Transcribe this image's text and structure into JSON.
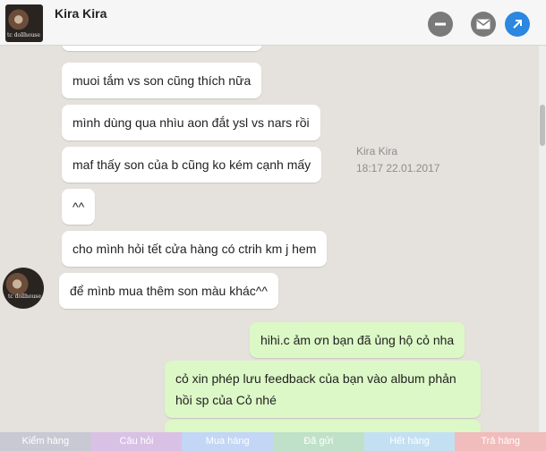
{
  "header": {
    "contact_name": "Kira Kira",
    "avatar_watermark": "tc dollhouse"
  },
  "messages": [
    {
      "text": "muoi tắm vs son cũng thích nữa"
    },
    {
      "text": "mình dùng qua nhìu aon đắt ysl vs nars rồi"
    },
    {
      "text": "maf thấy son của b cũng ko kém cạnh mấy"
    },
    {
      "text": "^^"
    },
    {
      "text": "cho mình hỏi tết cửa hàng có ctrih km j hem"
    },
    {
      "text": "để mìnb mua thêm son màu khác^^"
    },
    {
      "text": "hihi.c ảm ơn bạn đã ủng hộ cỏ nha"
    },
    {
      "text": "cỏ xin phép lưu feedback của bạn vào album phản hồi sp của Cỏ nhé"
    }
  ],
  "meta": {
    "sender": "Kira Kira",
    "timestamp": "18:17 22.01.2017"
  },
  "tabs": [
    {
      "label": "Kiểm hàng",
      "color": "#c9c9d4"
    },
    {
      "label": "Câu hỏi",
      "color": "#d9c1e6"
    },
    {
      "label": "Mua hàng",
      "color": "#c3d6f5"
    },
    {
      "label": "Đã gửi",
      "color": "#bfe1c9"
    },
    {
      "label": "Hết hàng",
      "color": "#c3e0f3"
    },
    {
      "label": "Trả hàng",
      "color": "#f1bcbc"
    }
  ],
  "icons": {
    "minimize": "minus-circle-icon",
    "mail": "mail-icon",
    "open": "arrow-up-right-icon"
  },
  "colors": {
    "accent": "#2b87e0",
    "my_bubble": "#dcf8c6"
  }
}
